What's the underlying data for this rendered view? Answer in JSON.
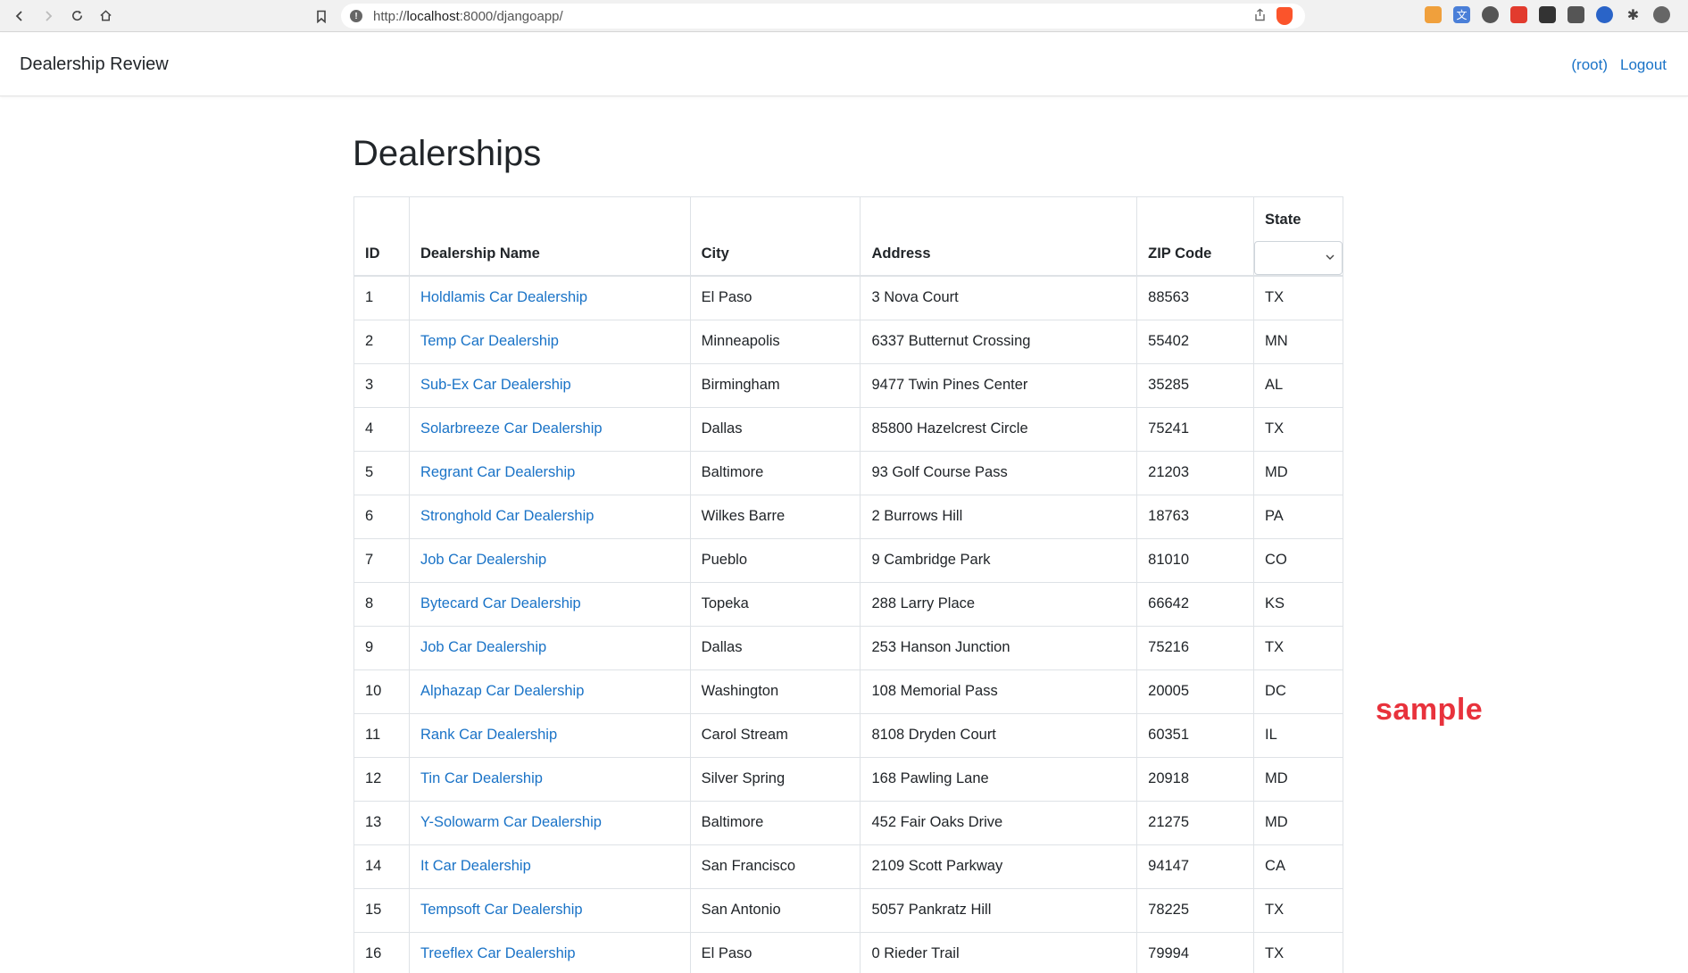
{
  "browser": {
    "url_prefix": "http://",
    "url_host": "localhost",
    "url_rest": ":8000/djangoapp/"
  },
  "navbar": {
    "brand": "Dealership Review",
    "user_link": "(root)",
    "logout_link": "Logout"
  },
  "page": {
    "title": "Dealerships"
  },
  "table": {
    "headers": {
      "id": "ID",
      "name": "Dealership Name",
      "city": "City",
      "address": "Address",
      "zip": "ZIP Code",
      "state": "State"
    },
    "state_filter_value": "",
    "rows": [
      {
        "id": "1",
        "name": "Holdlamis Car Dealership",
        "city": "El Paso",
        "address": "3 Nova Court",
        "zip": "88563",
        "state": "TX"
      },
      {
        "id": "2",
        "name": "Temp Car Dealership",
        "city": "Minneapolis",
        "address": "6337 Butternut Crossing",
        "zip": "55402",
        "state": "MN"
      },
      {
        "id": "3",
        "name": "Sub-Ex Car Dealership",
        "city": "Birmingham",
        "address": "9477 Twin Pines Center",
        "zip": "35285",
        "state": "AL"
      },
      {
        "id": "4",
        "name": "Solarbreeze Car Dealership",
        "city": "Dallas",
        "address": "85800 Hazelcrest Circle",
        "zip": "75241",
        "state": "TX"
      },
      {
        "id": "5",
        "name": "Regrant Car Dealership",
        "city": "Baltimore",
        "address": "93 Golf Course Pass",
        "zip": "21203",
        "state": "MD"
      },
      {
        "id": "6",
        "name": "Stronghold Car Dealership",
        "city": "Wilkes Barre",
        "address": "2 Burrows Hill",
        "zip": "18763",
        "state": "PA"
      },
      {
        "id": "7",
        "name": "Job Car Dealership",
        "city": "Pueblo",
        "address": "9 Cambridge Park",
        "zip": "81010",
        "state": "CO"
      },
      {
        "id": "8",
        "name": "Bytecard Car Dealership",
        "city": "Topeka",
        "address": "288 Larry Place",
        "zip": "66642",
        "state": "KS"
      },
      {
        "id": "9",
        "name": "Job Car Dealership",
        "city": "Dallas",
        "address": "253 Hanson Junction",
        "zip": "75216",
        "state": "TX"
      },
      {
        "id": "10",
        "name": "Alphazap Car Dealership",
        "city": "Washington",
        "address": "108 Memorial Pass",
        "zip": "20005",
        "state": "DC"
      },
      {
        "id": "11",
        "name": "Rank Car Dealership",
        "city": "Carol Stream",
        "address": "8108 Dryden Court",
        "zip": "60351",
        "state": "IL"
      },
      {
        "id": "12",
        "name": "Tin Car Dealership",
        "city": "Silver Spring",
        "address": "168 Pawling Lane",
        "zip": "20918",
        "state": "MD"
      },
      {
        "id": "13",
        "name": "Y-Solowarm Car Dealership",
        "city": "Baltimore",
        "address": "452 Fair Oaks Drive",
        "zip": "21275",
        "state": "MD"
      },
      {
        "id": "14",
        "name": "It Car Dealership",
        "city": "San Francisco",
        "address": "2109 Scott Parkway",
        "zip": "94147",
        "state": "CA"
      },
      {
        "id": "15",
        "name": "Tempsoft Car Dealership",
        "city": "San Antonio",
        "address": "5057 Pankratz Hill",
        "zip": "78225",
        "state": "TX"
      },
      {
        "id": "16",
        "name": "Treeflex Car Dealership",
        "city": "El Paso",
        "address": "0 Rieder Trail",
        "zip": "79994",
        "state": "TX"
      }
    ]
  },
  "watermark": "sample",
  "colors": {
    "link": "#1a73c7",
    "watermark": "#e8323c"
  }
}
